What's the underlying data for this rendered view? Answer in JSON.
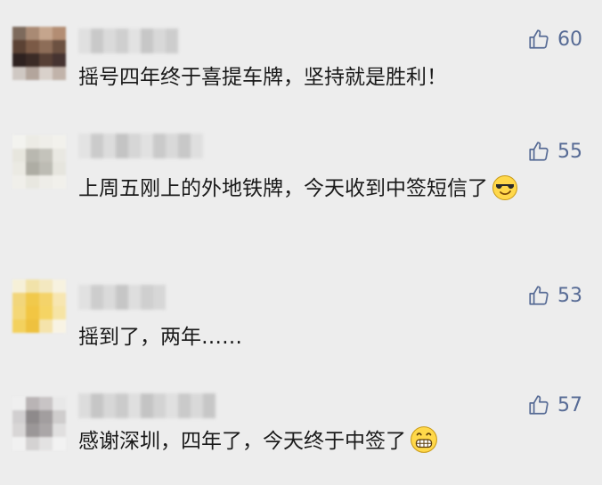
{
  "comments": [
    {
      "text": "摇号四年终于喜提车牌，坚持就是胜利！",
      "likes": "60",
      "emoji": ""
    },
    {
      "text": "上周五刚上的外地铁牌，今天收到中签短信了",
      "likes": "55",
      "emoji": "cool-face-emoji"
    },
    {
      "text": "摇到了，两年……",
      "likes": "53",
      "emoji": ""
    },
    {
      "text": "感谢深圳，四年了，今天终于中签了",
      "likes": "57",
      "emoji": "grin-face-emoji"
    }
  ],
  "icons": {
    "like": "thumbs-up-icon"
  },
  "colors": {
    "like": "#576b95",
    "background": "#ededed",
    "text": "#1a1a1a"
  }
}
